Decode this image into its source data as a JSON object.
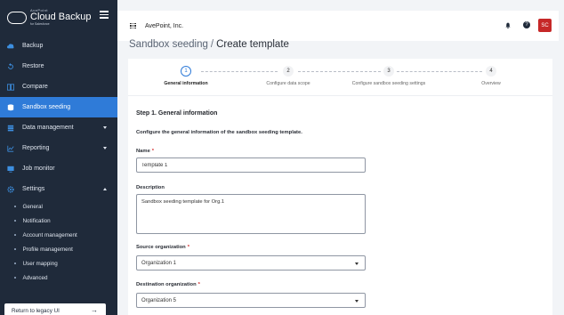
{
  "brand": {
    "tagline": "AvePoint",
    "name": "Cloud Backup",
    "sub": "for Salesforce"
  },
  "sidebar": {
    "items": [
      {
        "label": "Backup",
        "icon": "cloud-icon"
      },
      {
        "label": "Restore",
        "icon": "restore-icon"
      },
      {
        "label": "Compare",
        "icon": "compare-icon"
      },
      {
        "label": "Sandbox seeding",
        "icon": "database-icon",
        "active": true
      },
      {
        "label": "Data management",
        "icon": "data-icon"
      },
      {
        "label": "Reporting",
        "icon": "chart-icon"
      },
      {
        "label": "Job monitor",
        "icon": "monitor-icon"
      },
      {
        "label": "Settings",
        "icon": "gear-icon"
      }
    ],
    "settings_sub": [
      "General",
      "Notification",
      "Account management",
      "Profile management",
      "User mapping",
      "Advanced"
    ],
    "legacy_label": "Return to legacy UI"
  },
  "header": {
    "tenant": "AvePoint, Inc.",
    "help_label": "?",
    "avatar_initials": "SC"
  },
  "breadcrumb": {
    "parent": "Sandbox seeding",
    "separator": "/",
    "current": "Create template"
  },
  "steps": [
    {
      "number": "1",
      "label": "General information"
    },
    {
      "number": "2",
      "label": "Configure data scope"
    },
    {
      "number": "3",
      "label": "Configure sandbox seeding settings"
    },
    {
      "number": "4",
      "label": "Overview"
    }
  ],
  "form": {
    "section_title": "Step 1. General information",
    "section_desc": "Configure the general information of the sandbox seeding template.",
    "name_label": "Name",
    "required_mark": "*",
    "name_value": "Template 1",
    "description_label": "Description",
    "description_value": "Sandbox seeding template for Org.1",
    "source_label": "Source organization",
    "source_value": "Organization 1",
    "destination_label": "Destination organization",
    "destination_value": "Organization 5"
  },
  "colors": {
    "sidebar_bg": "#1f2a3a",
    "active": "#2f7bd8",
    "avatar": "#c62828"
  }
}
